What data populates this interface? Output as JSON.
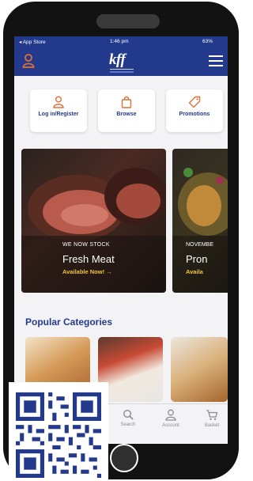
{
  "status_bar": {
    "carrier": "◂ App Store",
    "time": "1:46 pm",
    "battery": "63%"
  },
  "header": {
    "logo": "kff"
  },
  "quick_actions": [
    {
      "label": "Log in/Register",
      "icon": "user-icon"
    },
    {
      "label": "Browse",
      "icon": "bag-icon"
    },
    {
      "label": "Promotions",
      "icon": "tag-icon"
    }
  ],
  "banners": [
    {
      "line1": "WE NOW STOCK",
      "line2": "Fresh Meat",
      "cta": "Available Now! →"
    },
    {
      "line1": "NOVEMBE",
      "line2": "Pron",
      "cta": "Availa"
    }
  ],
  "section": {
    "title": "Popular Categories"
  },
  "bottom_nav": [
    {
      "label": "Search",
      "icon": "search-icon"
    },
    {
      "label": "Account",
      "icon": "account-icon"
    },
    {
      "label": "Basket",
      "icon": "basket-icon"
    }
  ],
  "colors": {
    "brand_blue": "#233a8c",
    "accent_orange": "#e0703a",
    "accent_yellow": "#f3c23b"
  }
}
